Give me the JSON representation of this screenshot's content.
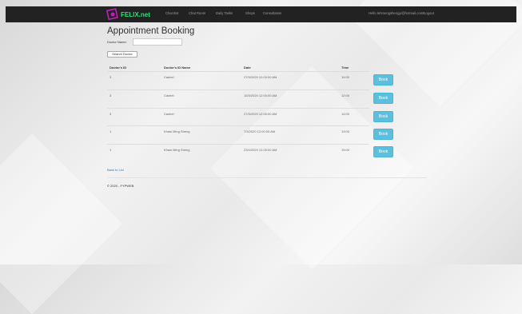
{
  "navbar": {
    "brand": "FELIX.net",
    "links": [
      "Chat Bot",
      "Chat Room",
      "Daily Tasks",
      "Shops",
      "Consultation"
    ],
    "user_email": "Hello tehmengshengyi@hotmail.com!!",
    "logout": "Logout"
  },
  "page_title": "Appointment Booking",
  "search": {
    "label": "Doctor Name:",
    "value": "",
    "button": "Search Doctor"
  },
  "table": {
    "headers": [
      "Doctor's ID",
      "Doctor's ID Name",
      "Date",
      "Time"
    ],
    "book_label": "Book",
    "rows": [
      {
        "id": "3",
        "name": "Cashel",
        "date": "27/3/2020 12:00:00 AM",
        "time": "14:00"
      },
      {
        "id": "3",
        "name": "Cashel",
        "date": "10/3/2020 12:00:00 AM",
        "time": "12:00"
      },
      {
        "id": "3",
        "name": "Cashel",
        "date": "27/3/2020 12:00:00 AM",
        "time": "14:00"
      },
      {
        "id": "1",
        "name": "Khaw Ming Sheng",
        "date": "7/3/2020 12:00:00 AM",
        "time": "13:00"
      },
      {
        "id": "1",
        "name": "Khaw Ming Sheng",
        "date": "23/4/2020 12:00:00 AM",
        "time": "15:00"
      }
    ]
  },
  "back_link": "Back to List",
  "footer": "© 2020 - FYPWEB",
  "colors": {
    "navbar_bg": "#222222",
    "brand": "#2de07a",
    "book_button": "#5bc0de",
    "link": "#337ab7"
  }
}
